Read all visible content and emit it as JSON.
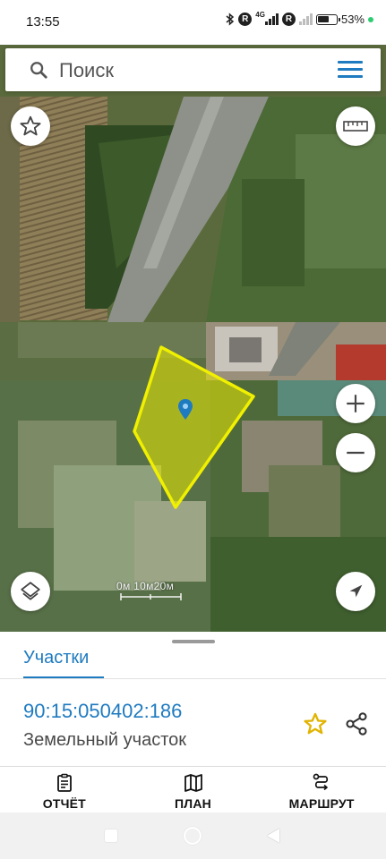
{
  "status_bar": {
    "time": "13:55",
    "network": "4G",
    "sim_badge": "R",
    "battery": "53%",
    "icons": [
      "bluetooth-icon",
      "sim-r-icon",
      "signal-icon",
      "battery-icon"
    ]
  },
  "search": {
    "placeholder": "Поиск",
    "value": ""
  },
  "map": {
    "scale_label": "0м 10м20м",
    "parcel_outline_color": "#f0f000",
    "marker_color": "#1f7bc0",
    "controls": [
      "favorite-star-icon",
      "ruler-icon",
      "zoom-in-icon",
      "zoom-out-icon",
      "layers-icon",
      "locate-arrow-icon"
    ]
  },
  "sheet": {
    "tab_label": "Участки",
    "parcel_number": "90:15:050402:186",
    "parcel_type": "Земельный участок",
    "accent_color": "#1f7bc0",
    "star_color": "#e0b400"
  },
  "actions": [
    {
      "label": "ОТЧЁТ",
      "icon": "report-icon"
    },
    {
      "label": "ПЛАН",
      "icon": "map-plan-icon"
    },
    {
      "label": "МАРШРУТ",
      "icon": "route-icon"
    }
  ]
}
